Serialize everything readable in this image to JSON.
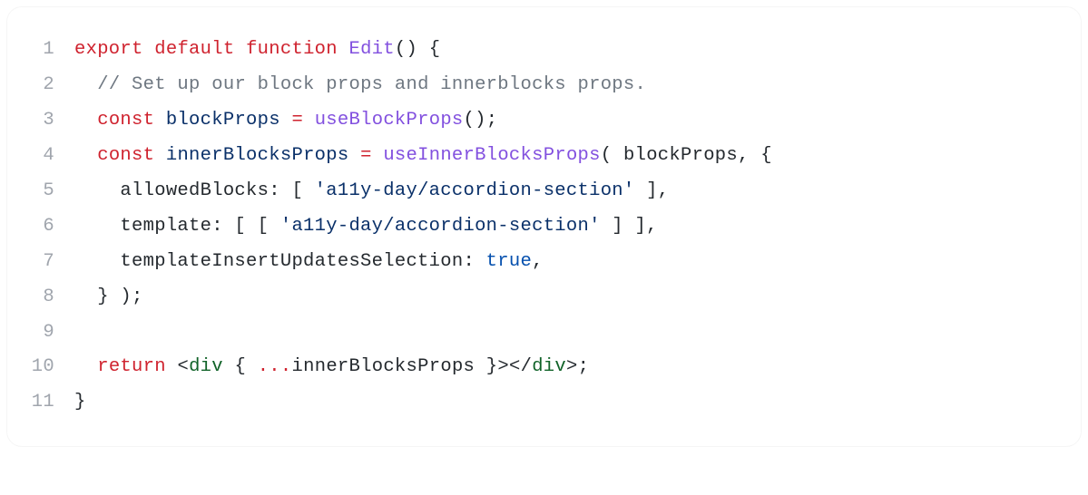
{
  "code": {
    "lines": [
      {
        "num": "1",
        "tokens": [
          {
            "t": "export",
            "c": "tok-keyword"
          },
          {
            "t": " ",
            "c": "tok-default"
          },
          {
            "t": "default",
            "c": "tok-keyword"
          },
          {
            "t": " ",
            "c": "tok-default"
          },
          {
            "t": "function",
            "c": "tok-keyword"
          },
          {
            "t": " ",
            "c": "tok-default"
          },
          {
            "t": "Edit",
            "c": "tok-function"
          },
          {
            "t": "()",
            "c": "tok-paren"
          },
          {
            "t": " ",
            "c": "tok-default"
          },
          {
            "t": "{",
            "c": "tok-brace"
          }
        ]
      },
      {
        "num": "2",
        "tokens": [
          {
            "t": "  ",
            "c": "tok-default"
          },
          {
            "t": "// Set up our block props and innerblocks props.",
            "c": "tok-comment"
          }
        ]
      },
      {
        "num": "3",
        "tokens": [
          {
            "t": "  ",
            "c": "tok-default"
          },
          {
            "t": "const",
            "c": "tok-keyword"
          },
          {
            "t": " ",
            "c": "tok-default"
          },
          {
            "t": "blockProps",
            "c": "tok-identifier"
          },
          {
            "t": " ",
            "c": "tok-default"
          },
          {
            "t": "=",
            "c": "tok-operator"
          },
          {
            "t": " ",
            "c": "tok-default"
          },
          {
            "t": "useBlockProps",
            "c": "tok-function"
          },
          {
            "t": "();",
            "c": "tok-paren"
          }
        ]
      },
      {
        "num": "4",
        "tokens": [
          {
            "t": "  ",
            "c": "tok-default"
          },
          {
            "t": "const",
            "c": "tok-keyword"
          },
          {
            "t": " ",
            "c": "tok-default"
          },
          {
            "t": "innerBlocksProps",
            "c": "tok-identifier"
          },
          {
            "t": " ",
            "c": "tok-default"
          },
          {
            "t": "=",
            "c": "tok-operator"
          },
          {
            "t": " ",
            "c": "tok-default"
          },
          {
            "t": "useInnerBlocksProps",
            "c": "tok-function"
          },
          {
            "t": "( ",
            "c": "tok-paren"
          },
          {
            "t": "blockProps, ",
            "c": "tok-default"
          },
          {
            "t": "{",
            "c": "tok-brace"
          }
        ]
      },
      {
        "num": "5",
        "tokens": [
          {
            "t": "    allowedBlocks: [ ",
            "c": "tok-default"
          },
          {
            "t": "'a11y-day/accordion-section'",
            "c": "tok-string"
          },
          {
            "t": " ],",
            "c": "tok-default"
          }
        ]
      },
      {
        "num": "6",
        "tokens": [
          {
            "t": "    template: [ [ ",
            "c": "tok-default"
          },
          {
            "t": "'a11y-day/accordion-section'",
            "c": "tok-string"
          },
          {
            "t": " ] ],",
            "c": "tok-default"
          }
        ]
      },
      {
        "num": "7",
        "tokens": [
          {
            "t": "    templateInsertUpdatesSelection: ",
            "c": "tok-default"
          },
          {
            "t": "true",
            "c": "tok-bool"
          },
          {
            "t": ",",
            "c": "tok-default"
          }
        ]
      },
      {
        "num": "8",
        "tokens": [
          {
            "t": "  ",
            "c": "tok-default"
          },
          {
            "t": "}",
            "c": "tok-brace"
          },
          {
            "t": " );",
            "c": "tok-paren"
          }
        ]
      },
      {
        "num": "9",
        "tokens": [
          {
            "t": "",
            "c": "tok-default"
          }
        ]
      },
      {
        "num": "10",
        "tokens": [
          {
            "t": "  ",
            "c": "tok-default"
          },
          {
            "t": "return",
            "c": "tok-keyword"
          },
          {
            "t": " ",
            "c": "tok-default"
          },
          {
            "t": "<",
            "c": "tok-punct"
          },
          {
            "t": "div",
            "c": "tok-tag"
          },
          {
            "t": " ",
            "c": "tok-default"
          },
          {
            "t": "{",
            "c": "tok-brace"
          },
          {
            "t": " ",
            "c": "tok-default"
          },
          {
            "t": "...",
            "c": "tok-operator"
          },
          {
            "t": "innerBlocksProps ",
            "c": "tok-default"
          },
          {
            "t": "}",
            "c": "tok-brace"
          },
          {
            "t": ">",
            "c": "tok-punct"
          },
          {
            "t": "</",
            "c": "tok-punct"
          },
          {
            "t": "div",
            "c": "tok-tag"
          },
          {
            "t": ">;",
            "c": "tok-punct"
          }
        ]
      },
      {
        "num": "11",
        "tokens": [
          {
            "t": "}",
            "c": "tok-brace"
          }
        ]
      }
    ]
  }
}
